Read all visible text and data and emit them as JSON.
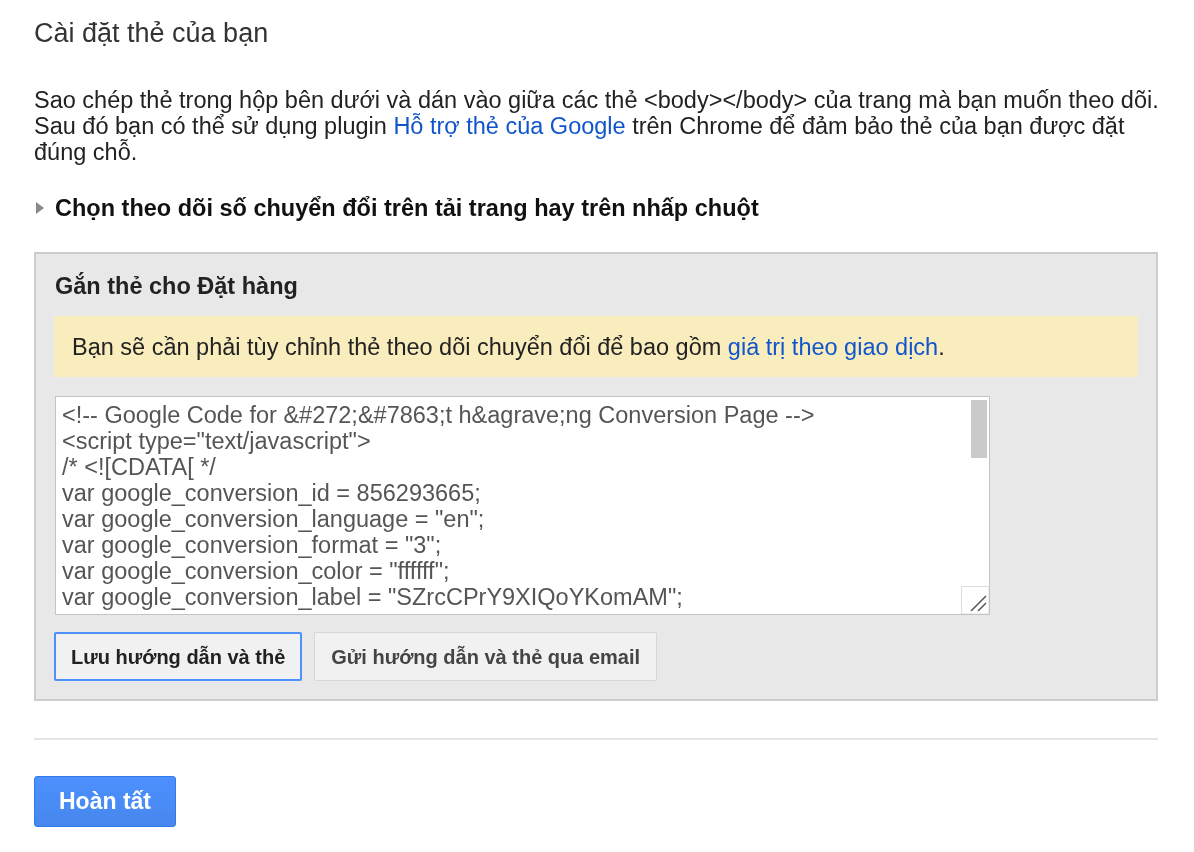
{
  "page_title": "Cài đặt thẻ của bạn",
  "intro": [
    {
      "kind": "text",
      "text": "Sao chép thẻ trong hộp bên dưới và dán vào giữa các thẻ <body></body> của trang mà bạn muốn theo dõi. Sau đó bạn có thể sử dụng plugin "
    },
    {
      "kind": "link",
      "text": "Hỗ trợ thẻ của Google"
    },
    {
      "kind": "text",
      "text": " trên Chrome để đảm bảo thẻ của bạn được đặt đúng chỗ."
    }
  ],
  "disclosure": {
    "label": "Chọn theo dõi số chuyển đổi trên tải trang hay trên nhấp chuột",
    "expanded": false
  },
  "tag_panel": {
    "title": "Gắn thẻ cho Đặt hàng",
    "notice": [
      {
        "kind": "text",
        "text": "Bạn sẽ cần phải tùy chỉnh thẻ theo dõi chuyển đổi để bao gồm "
      },
      {
        "kind": "link",
        "text": "giá trị theo giao dịch"
      },
      {
        "kind": "text",
        "text": "."
      }
    ],
    "code_lines": [
      "<!-- Google Code for &#272;&#7863;t h&agrave;ng Conversion Page -->",
      "<script type=\"text/javascript\">",
      "/* <![CDATA[ */",
      "var google_conversion_id = 856293665;",
      "var google_conversion_language = \"en\";",
      "var google_conversion_format = \"3\";",
      "var google_conversion_color = \"ffffff\";",
      "var google_conversion_label = \"SZrcCPrY9XIQoYKomAM\";"
    ],
    "buttons": [
      {
        "label": "Lưu hướng dẫn và thẻ",
        "focused": true
      },
      {
        "label": "Gửi hướng dẫn và thẻ qua email",
        "focused": false
      }
    ]
  },
  "done_button": {
    "label": "Hoàn tất"
  }
}
